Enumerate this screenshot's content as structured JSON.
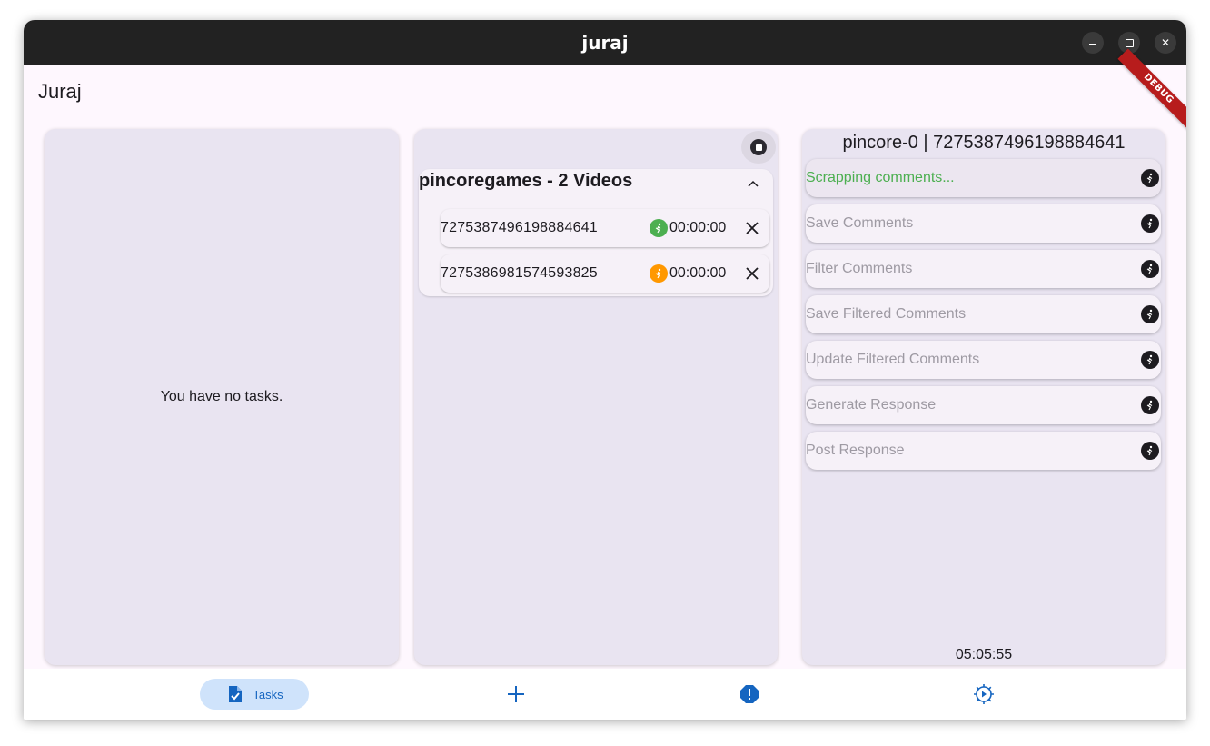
{
  "window": {
    "title": "juraj"
  },
  "app": {
    "title": "Juraj",
    "debug_label": "DEBUG"
  },
  "tasks_panel": {
    "empty_text": "You have no tasks."
  },
  "queue_panel": {
    "group_title": "pincoregames - 2 Videos",
    "videos": [
      {
        "id": "7275387496198884641",
        "status": "running",
        "status_color": "#4caf50",
        "timer": "00:00:00"
      },
      {
        "id": "7275386981574593825",
        "status": "pending",
        "status_color": "#ff9800",
        "timer": "00:00:00"
      }
    ]
  },
  "detail_panel": {
    "title": "pincore-0 | 7275387496198884641",
    "steps": [
      {
        "label": "Scrapping comments...",
        "active": true
      },
      {
        "label": "Save Comments",
        "active": false
      },
      {
        "label": "Filter Comments",
        "active": false
      },
      {
        "label": "Save Filtered Comments",
        "active": false
      },
      {
        "label": "Update Filtered Comments",
        "active": false
      },
      {
        "label": "Generate Response",
        "active": false
      },
      {
        "label": "Post Response",
        "active": false
      }
    ],
    "elapsed": "05:05:55",
    "active_color": "#4caf50"
  },
  "navbar": {
    "items": [
      {
        "label": "Tasks",
        "icon": "task-document-icon",
        "selected": true
      },
      {
        "label": "",
        "icon": "plus-icon"
      },
      {
        "label": "",
        "icon": "alert-octagon-icon"
      },
      {
        "label": "",
        "icon": "gear-icon"
      }
    ],
    "accent": "#1565c0"
  }
}
